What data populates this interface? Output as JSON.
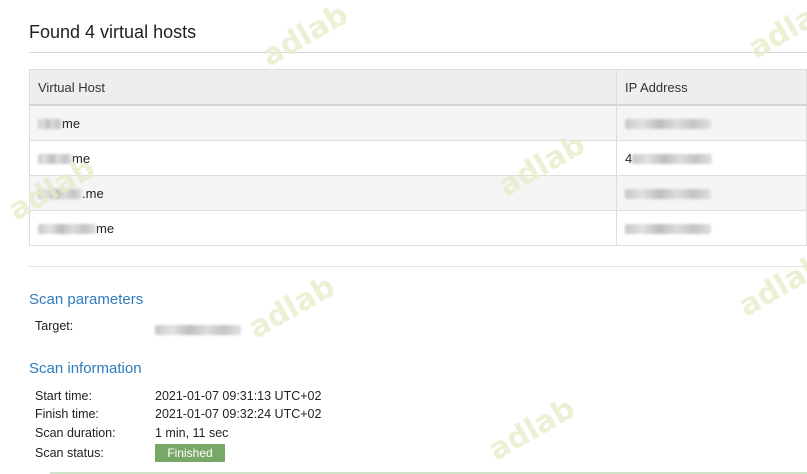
{
  "header": {
    "title": "Found 4 virtual hosts"
  },
  "hosts_table": {
    "columns": [
      "Virtual Host",
      "IP Address"
    ],
    "rows": [
      {
        "host_suffix": "me"
      },
      {
        "host_suffix": "me",
        "ip_prefix": "4"
      },
      {
        "host_suffix": ".me"
      },
      {
        "host_suffix": "me"
      }
    ]
  },
  "scan_parameters": {
    "heading": "Scan parameters",
    "target_label": "Target:"
  },
  "scan_information": {
    "heading": "Scan information",
    "start_label": "Start time:",
    "start_value": "2021-01-07 09:31:13 UTC+02",
    "finish_label": "Finish time:",
    "finish_value": "2021-01-07 09:32:24 UTC+02",
    "duration_label": "Scan duration:",
    "duration_value": "1 min, 11 sec",
    "status_label": "Scan status:",
    "status_value": "Finished"
  },
  "watermark_text": "adlab",
  "colors": {
    "section_heading": "#2f7bbd",
    "status_badge": "#77a865",
    "watermark": "#e6ecc8"
  }
}
